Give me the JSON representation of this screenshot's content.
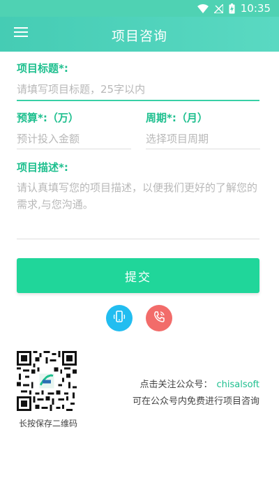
{
  "status": {
    "time": "10:35"
  },
  "header": {
    "title": "项目咨询"
  },
  "form": {
    "title_label": "项目标题*:",
    "title_placeholder": "请填写项目标题，25字以内",
    "budget_label": "预算*:（万）",
    "budget_placeholder": "预计投入金额",
    "period_label": "周期*:（月）",
    "period_placeholder": "选择项目周期",
    "desc_label": "项目描述*:",
    "desc_placeholder": "请认真填写您的项目描述，以便我们更好的了解您的需求,与您沟通。",
    "submit_label": "提交"
  },
  "contact": {
    "phone_icon": "mobile-phone-icon",
    "call_icon": "phone-call-icon"
  },
  "footer": {
    "qr_caption": "长按保存二维码",
    "follow_label": "点击关注公众号：",
    "account": "chisalsoft",
    "free_text": "可在公众号内免费进行项目咨询"
  },
  "colors": {
    "accent": "#1dbf8e",
    "header": "#4fd2b3",
    "submit": "#20d69a",
    "blue_button": "#22bdf0",
    "red_button": "#f26c6a"
  }
}
